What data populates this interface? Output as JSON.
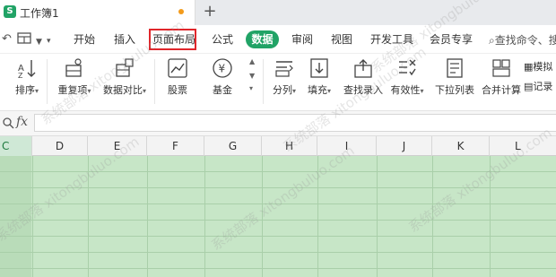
{
  "tab": {
    "logo": "S",
    "title": "工作簿1",
    "new_tab": "+"
  },
  "menu": {
    "items": [
      "开始",
      "插入",
      "页面布局",
      "公式",
      "审阅",
      "视图",
      "开发工具",
      "会员专享"
    ],
    "active": "数据",
    "highlighted": "页面布局",
    "search": "查找命令、搜"
  },
  "ribbon": {
    "buttons": [
      "排序",
      "重复项",
      "数据对比",
      "股票",
      "基金",
      "分列",
      "填充",
      "查找录入",
      "有效性",
      "下拉列表",
      "合并计算",
      "模拟",
      "记录"
    ]
  },
  "formula": {
    "fx": "fx",
    "value": ""
  },
  "columns": [
    "C",
    "D",
    "E",
    "F",
    "G",
    "H",
    "I",
    "J",
    "K",
    "L"
  ],
  "selected_column": "C",
  "watermark": "系统部落 xitongbuluo.com",
  "colors": {
    "accent": "#21a366",
    "highlight_box": "#e0262b",
    "sheet_fill": "#c7e6c7"
  }
}
